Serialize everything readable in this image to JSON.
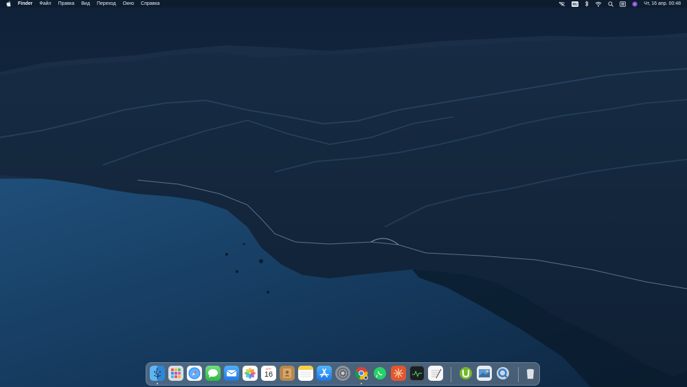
{
  "menubar": {
    "app_name": "Finder",
    "items": [
      "Файл",
      "Правка",
      "Вид",
      "Переход",
      "Окно",
      "Справка"
    ],
    "input_source": "RU",
    "clock": "Чт, 16 апр.  00:48"
  },
  "dock": {
    "apps": [
      {
        "name": "Finder",
        "icon": "finder-icon",
        "running": true
      },
      {
        "name": "Launchpad",
        "icon": "launchpad-icon",
        "running": false
      },
      {
        "name": "Safari",
        "icon": "safari-icon",
        "running": false
      },
      {
        "name": "Messages",
        "icon": "messages-icon",
        "running": false
      },
      {
        "name": "Mail",
        "icon": "mail-icon",
        "running": false
      },
      {
        "name": "Photos",
        "icon": "photos-icon",
        "running": false
      },
      {
        "name": "Calendar",
        "icon": "calendar-icon",
        "running": false
      },
      {
        "name": "Contacts",
        "icon": "contacts-icon",
        "running": false
      },
      {
        "name": "Notes",
        "icon": "notes-icon",
        "running": false
      },
      {
        "name": "App Store",
        "icon": "app-store-icon",
        "running": false
      },
      {
        "name": "System Preferences",
        "icon": "system-preferences-icon",
        "running": false
      },
      {
        "name": "Google Chrome",
        "icon": "chrome-icon",
        "running": true
      },
      {
        "name": "WhatsApp",
        "icon": "whatsapp-icon",
        "running": false
      },
      {
        "name": "Grapher",
        "icon": "grapher-icon",
        "running": false
      },
      {
        "name": "Activity Monitor",
        "icon": "activity-monitor-icon",
        "running": false
      },
      {
        "name": "TextEdit",
        "icon": "textedit-icon",
        "running": false
      },
      {
        "name": "uTorrent",
        "icon": "utorrent-icon",
        "running": false
      },
      {
        "name": "Preview",
        "icon": "preview-icon",
        "running": false
      },
      {
        "name": "QuickTime Player",
        "icon": "quicktime-icon",
        "running": false
      },
      {
        "name": "Trash",
        "icon": "trash-icon",
        "running": false
      }
    ],
    "calendar_month": "АПР.",
    "calendar_day": "16"
  },
  "colors": {
    "menubar_text": "#e8ecf2",
    "wallpaper_sky": "#1c3450",
    "wallpaper_sea": "#1b4870",
    "wallpaper_hills": "#13283d"
  }
}
